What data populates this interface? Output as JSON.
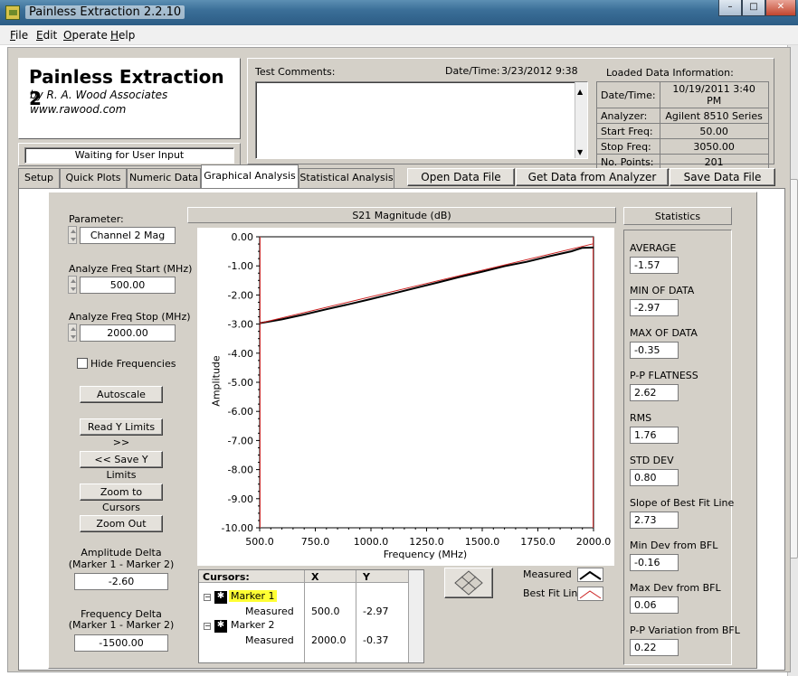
{
  "window": {
    "title": "Painless Extraction 2.2.10",
    "controls": [
      "minimize",
      "maximize",
      "close"
    ]
  },
  "menu": [
    {
      "label": "File",
      "accel": "F",
      "rest": "ile"
    },
    {
      "label": "Edit",
      "accel": "E",
      "rest": "dit"
    },
    {
      "label": "Operate",
      "accel": "O",
      "rest": "perate"
    },
    {
      "label": "Help",
      "accel": "H",
      "rest": "elp"
    }
  ],
  "header": {
    "app_name": "Painless Extraction 2",
    "by_line": "by R. A. Wood Associates",
    "website": "www.rawood.com",
    "status": "Waiting for User Input",
    "test_comments_label": "Test Comments:",
    "test_comments_value": "",
    "datetime_label": "Date/Time:",
    "datetime_value": "3/23/2012  9:38"
  },
  "loaded_data": {
    "title": "Loaded Data Information:",
    "rows": [
      {
        "key": "Date/Time:",
        "value": "10/19/2011 3:40 PM"
      },
      {
        "key": "Analyzer:",
        "value": "Agilent 8510 Series"
      },
      {
        "key": "Start Freq:",
        "value": "50.00"
      },
      {
        "key": "Stop Freq:",
        "value": "3050.00"
      },
      {
        "key": "No. Points:",
        "value": "201"
      }
    ]
  },
  "tabs": [
    {
      "label": "Setup",
      "active": false
    },
    {
      "label": "Quick Plots",
      "active": false
    },
    {
      "label": "Numeric Data",
      "active": false
    },
    {
      "label": "Graphical Analysis",
      "active": true
    },
    {
      "label": "Statistical Analysis",
      "active": false
    }
  ],
  "file_buttons": {
    "open": "Open Data File",
    "get": "Get Data from Analyzer",
    "save": "Save Data File"
  },
  "controls": {
    "parameter_label": "Parameter:",
    "parameter_value": "Channel 2 Mag",
    "start_label": "Analyze Freq Start (MHz)",
    "start_value": "500.00",
    "stop_label": "Analyze Freq Stop (MHz)",
    "stop_value": "2000.00",
    "hide_freq_label": "Hide Frequencies",
    "hide_freq_checked": false,
    "autoscale": "Autoscale",
    "read_y": "Read Y Limits >>",
    "save_y": "<< Save Y Limits",
    "zoom_cursors": "Zoom to Cursors",
    "zoom_out": "Zoom Out",
    "amp_delta_label_1": "Amplitude Delta",
    "amp_delta_label_2": "(Marker 1 - Marker 2)",
    "amp_delta_value": "-2.60",
    "freq_delta_label_1": "Frequency Delta",
    "freq_delta_label_2": "(Marker 1 - Marker 2)",
    "freq_delta_value": "-1500.00"
  },
  "chart_data": {
    "type": "line",
    "title": "S21 Magnitude (dB)",
    "xlabel": "Frequency (MHz)",
    "ylabel": "Amplitude",
    "xlim": [
      500,
      2000
    ],
    "ylim": [
      -10,
      0
    ],
    "xticks": [
      "500.0",
      "750.0",
      "1000.0",
      "1250.0",
      "1500.0",
      "1750.0",
      "2000.0"
    ],
    "yticks": [
      "0.00",
      "-1.00",
      "-2.00",
      "-3.00",
      "-4.00",
      "-5.00",
      "-6.00",
      "-7.00",
      "-8.00",
      "-9.00",
      "-10.00"
    ],
    "grid": false,
    "series": [
      {
        "name": "Measured",
        "color": "#000000",
        "x": [
          500,
          600,
          700,
          800,
          900,
          1000,
          1100,
          1200,
          1300,
          1400,
          1500,
          1600,
          1700,
          1800,
          1900,
          1950,
          2000
        ],
        "y": [
          -2.97,
          -2.84,
          -2.67,
          -2.49,
          -2.32,
          -2.14,
          -1.95,
          -1.76,
          -1.57,
          -1.38,
          -1.2,
          -1.01,
          -0.86,
          -0.67,
          -0.5,
          -0.38,
          -0.37
        ]
      },
      {
        "name": "Best Fit Line",
        "color": "#cc2020",
        "x": [
          500,
          2000
        ],
        "y": [
          -2.97,
          -0.24
        ]
      }
    ]
  },
  "cursors": {
    "header": {
      "name": "Cursors:",
      "x": "X",
      "y": "Y"
    },
    "items": [
      {
        "label": "Marker 1",
        "sub": "Measured",
        "x": "500.0",
        "y": "-2.97",
        "highlight": true
      },
      {
        "label": "Marker 2",
        "sub": "Measured",
        "x": "2000.0",
        "y": "-0.37",
        "highlight": false
      }
    ]
  },
  "legend": [
    {
      "label": "Measured",
      "color": "#000000"
    },
    {
      "label": "Best Fit Line",
      "color": "#cc2020"
    }
  ],
  "statistics": {
    "title": "Statistics",
    "items": [
      {
        "label": "AVERAGE",
        "value": "-1.57"
      },
      {
        "label": "MIN OF DATA",
        "value": "-2.97"
      },
      {
        "label": "MAX OF DATA",
        "value": "-0.35"
      },
      {
        "label": "P-P FLATNESS",
        "value": "2.62"
      },
      {
        "label": "RMS",
        "value": "1.76"
      },
      {
        "label": "STD DEV",
        "value": "0.80"
      },
      {
        "label": "Slope of Best Fit Line",
        "value": "2.73"
      },
      {
        "label": "Min Dev from BFL",
        "value": "-0.16"
      },
      {
        "label": "Max Dev from BFL",
        "value": "0.06"
      },
      {
        "label": "P-P Variation from BFL",
        "value": "0.22"
      }
    ]
  }
}
